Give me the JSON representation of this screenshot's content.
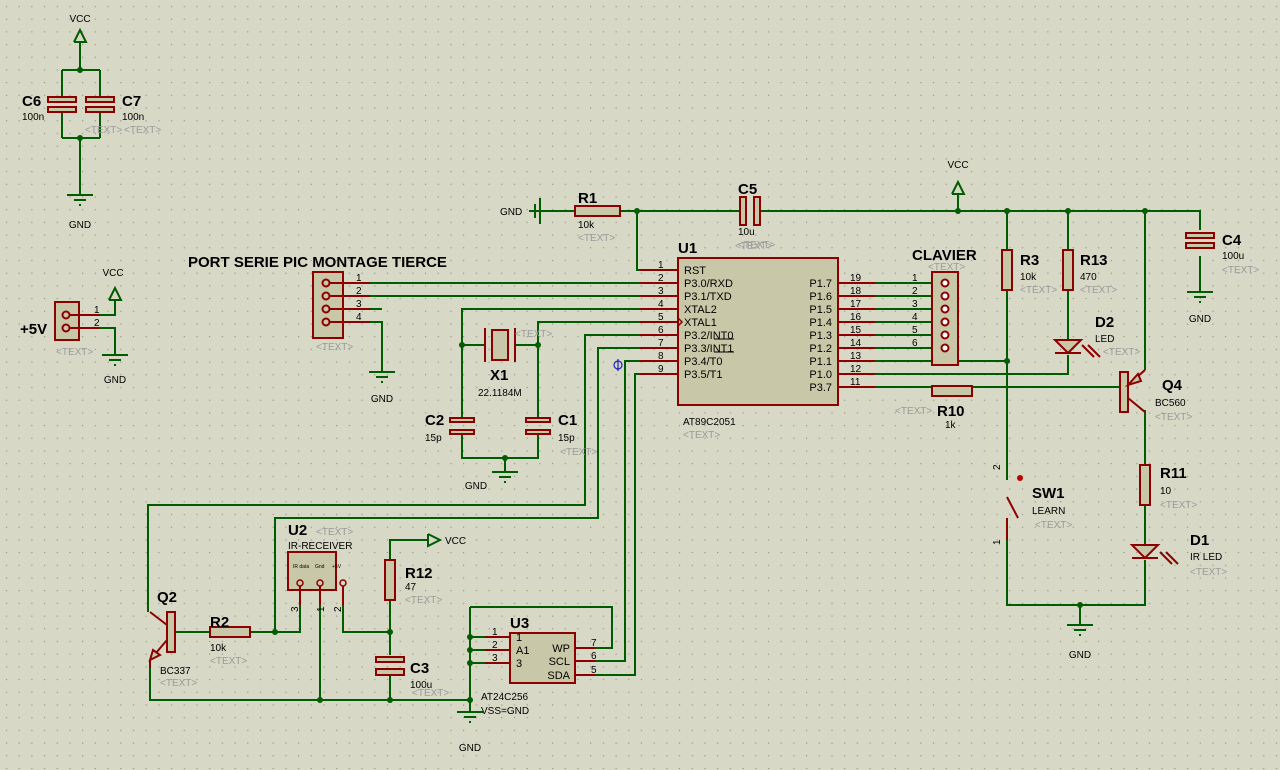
{
  "colors": {
    "background": "#d8d8c6",
    "wire": "#005c00",
    "component_outline": "#8c0000",
    "component_fill": "#c8c8a8",
    "grid_dot": "#7a7a6a"
  },
  "placeholder_text": "<TEXT>",
  "power": {
    "vcc": "VCC",
    "gnd": "GND"
  },
  "title_port": "PORT SERIE PIC MONTAGE TIERCE",
  "components": {
    "C6": {
      "ref": "C6",
      "value": "100n"
    },
    "C7": {
      "ref": "C7",
      "value": "100n"
    },
    "PWR": {
      "ref": "+5V"
    },
    "R1": {
      "ref": "R1",
      "value": "10k"
    },
    "C5": {
      "ref": "C5",
      "value": "10u"
    },
    "C4": {
      "ref": "C4",
      "value": "100u"
    },
    "R3": {
      "ref": "R3",
      "value": "10k"
    },
    "R13": {
      "ref": "R13",
      "value": "470"
    },
    "D2": {
      "ref": "D2",
      "value": "LED"
    },
    "Q4": {
      "ref": "Q4",
      "value": "BC560"
    },
    "R10": {
      "ref": "R10",
      "value": "1k"
    },
    "R11": {
      "ref": "R11",
      "value": "10"
    },
    "D1": {
      "ref": "D1",
      "value": "IR LED"
    },
    "SW1": {
      "ref": "SW1",
      "value": "LEARN"
    },
    "X1": {
      "ref": "X1",
      "value": "22.1184M"
    },
    "C2": {
      "ref": "C2",
      "value": "15p"
    },
    "C1": {
      "ref": "C1",
      "value": "15p"
    },
    "U1": {
      "ref": "U1",
      "value": "AT89C2051",
      "left_pins": [
        {
          "n": "1",
          "name": "RST"
        },
        {
          "n": "2",
          "name": "P3.0/RXD"
        },
        {
          "n": "3",
          "name": "P3.1/TXD"
        },
        {
          "n": "4",
          "name": "XTAL2"
        },
        {
          "n": "5",
          "name": "XTAL1"
        },
        {
          "n": "6",
          "name": "P3.2/INT0"
        },
        {
          "n": "7",
          "name": "P3.3/INT1"
        },
        {
          "n": "8",
          "name": "P3.4/T0"
        },
        {
          "n": "9",
          "name": "P3.5/T1"
        }
      ],
      "right_pins": [
        {
          "n": "19",
          "name": "P1.7"
        },
        {
          "n": "18",
          "name": "P1.6"
        },
        {
          "n": "17",
          "name": "P1.5"
        },
        {
          "n": "16",
          "name": "P1.4"
        },
        {
          "n": "15",
          "name": "P1.3"
        },
        {
          "n": "14",
          "name": "P1.2"
        },
        {
          "n": "13",
          "name": "P1.1"
        },
        {
          "n": "12",
          "name": "P1.0"
        },
        {
          "n": "11",
          "name": "P3.7"
        }
      ]
    },
    "CLAVIER": {
      "ref": "CLAVIER",
      "pins": [
        "1",
        "2",
        "3",
        "4",
        "5",
        "6"
      ]
    },
    "PORT": {
      "pins": [
        "1",
        "2",
        "3",
        "4"
      ]
    },
    "PWRPINS": {
      "pins": [
        "1",
        "2"
      ]
    },
    "U2": {
      "ref": "U2",
      "value": "IR-RECEIVER",
      "pin_labels": [
        "IR data",
        "Gnd",
        "+5V"
      ],
      "pins": [
        "3",
        "1",
        "2"
      ]
    },
    "R12": {
      "ref": "R12",
      "value": "47"
    },
    "C3": {
      "ref": "C3",
      "value": "100u"
    },
    "U3": {
      "ref": "U3",
      "value": "AT24C256",
      "value2": "VSS=GND",
      "left_pins": [
        {
          "n": "1",
          "name": "1"
        },
        {
          "n": "2",
          "name": "A1"
        },
        {
          "n": "3",
          "name": "3"
        }
      ],
      "right_pins": [
        {
          "n": "7",
          "name": "WP"
        },
        {
          "n": "6",
          "name": "SCL"
        },
        {
          "n": "5",
          "name": "SDA"
        }
      ]
    },
    "Q2": {
      "ref": "Q2",
      "value": "BC337"
    },
    "R2": {
      "ref": "R2",
      "value": "10k"
    },
    "SWpins": [
      "2",
      "1"
    ]
  }
}
